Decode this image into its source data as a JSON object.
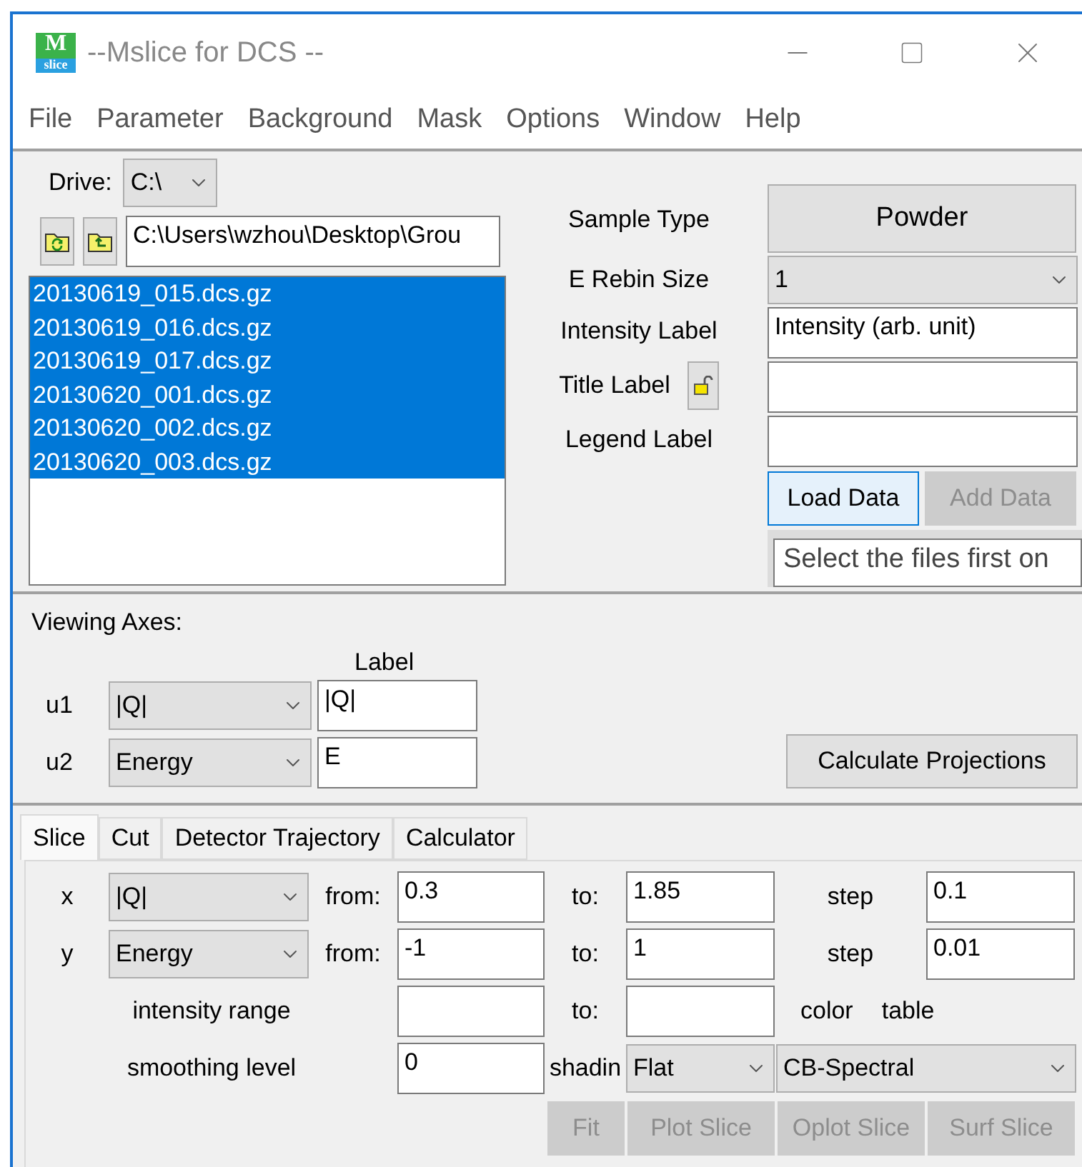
{
  "window": {
    "title": "--Mslice for DCS --",
    "logo": {
      "top": "M",
      "bottom": "slice"
    }
  },
  "menu": [
    "File",
    "Parameter",
    "Background",
    "Mask",
    "Options",
    "Window",
    "Help"
  ],
  "files": {
    "drive_label": "Drive:",
    "drive": "C:\\",
    "path": "C:\\Users\\wzhou\\Desktop\\Grou",
    "items": [
      {
        "name": "20130619_015.dcs.gz",
        "selected": true
      },
      {
        "name": "20130619_016.dcs.gz",
        "selected": true
      },
      {
        "name": "20130619_017.dcs.gz",
        "selected": true
      },
      {
        "name": "20130620_001.dcs.gz",
        "selected": true
      },
      {
        "name": "20130620_002.dcs.gz",
        "selected": true
      },
      {
        "name": "20130620_003.dcs.gz",
        "selected": true
      }
    ]
  },
  "sample": {
    "rows": [
      {
        "label": "Sample Type",
        "kind": "button",
        "value": "Powder"
      },
      {
        "label": "E Rebin Size",
        "kind": "dropdown",
        "value": "1"
      },
      {
        "label": "Intensity Label",
        "kind": "field",
        "value": "Intensity (arb. unit)"
      },
      {
        "label": "Title Label",
        "kind": "field",
        "lock": true
      },
      {
        "label": "Legend Label",
        "kind": "field"
      }
    ],
    "buttons": [
      {
        "label": "Load Data",
        "disabled": false,
        "focused": true
      },
      {
        "label": "Add Data",
        "disabled": true,
        "focused": false
      }
    ],
    "hint": "Select the files first on"
  },
  "viewing_axes": {
    "title": "Viewing Axes:",
    "label_heading": "Label",
    "axes": [
      {
        "name": "u1",
        "choice": "|Q|",
        "label": "|Q|"
      },
      {
        "name": "u2",
        "choice": "Energy",
        "label": "E"
      }
    ],
    "button": "Calculate Projections"
  },
  "tabs": [
    {
      "label": "Slice",
      "selected": true
    },
    {
      "label": "Cut",
      "selected": false
    },
    {
      "label": "Detector Trajectory",
      "selected": false
    },
    {
      "label": "Calculator",
      "selected": false
    }
  ],
  "slice": {
    "axes": [
      {
        "name": "x",
        "choice": "|Q|",
        "from_label": "from:",
        "from": "0.3",
        "to_label": "to:",
        "to": "1.85",
        "step_label": "step",
        "step": "0.1"
      },
      {
        "name": "y",
        "choice": "Energy",
        "from_label": "from:",
        "from": "-1",
        "to_label": "to:",
        "to": "1",
        "step_label": "step",
        "step": "0.01"
      }
    ],
    "intensity": {
      "label": "intensity range",
      "to_label": "to:",
      "color_label": "color",
      "table_label": "table"
    },
    "smoothing": {
      "label": "smoothing level",
      "value": "0",
      "shading_label": "shadin",
      "shading": "Flat",
      "color_table": "CB-Spectral"
    },
    "buttons": [
      {
        "label": "Fit",
        "disabled": true
      },
      {
        "label": "Plot Slice",
        "disabled": true
      },
      {
        "label": "Oplot Slice",
        "disabled": true
      },
      {
        "label": "Surf Slice",
        "disabled": true
      }
    ]
  }
}
